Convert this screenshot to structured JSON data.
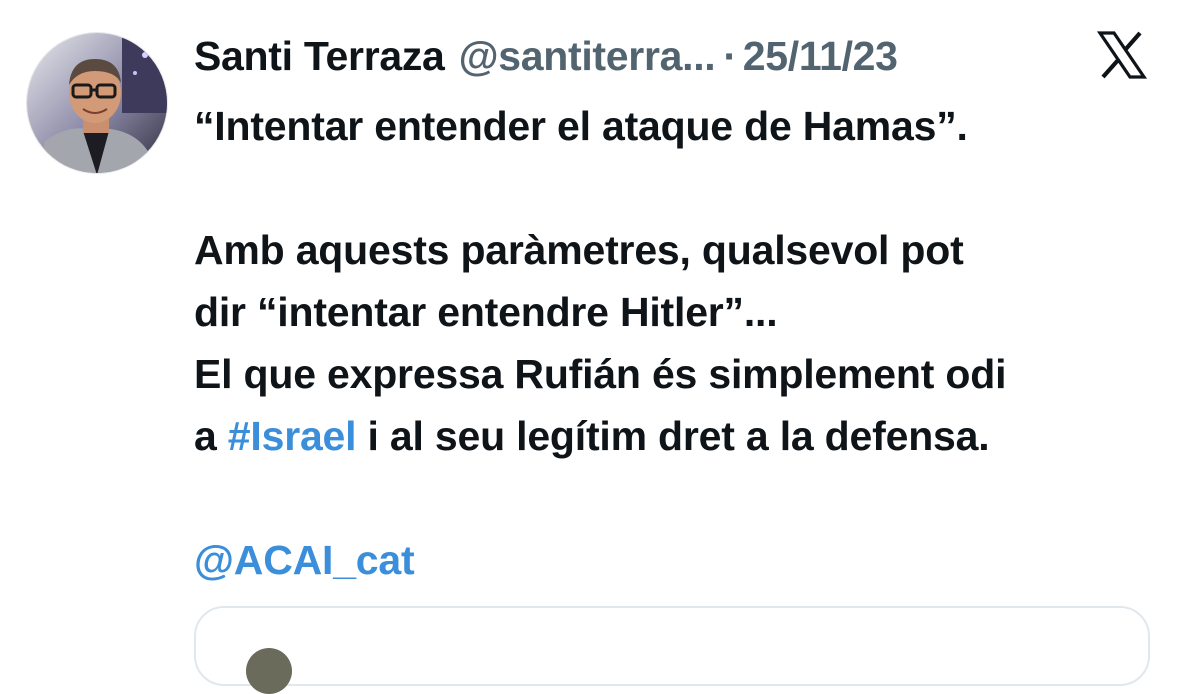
{
  "author": {
    "name": "Santi Terraza",
    "handle": "@santiterra...",
    "separator": "·",
    "date": "25/11/23"
  },
  "icons": {
    "avatar": "profile-photo",
    "platform": "x-logo-icon"
  },
  "tweet": {
    "line1": "“Intentar entender el ataque de Hamas”.",
    "line2": "Amb aquests paràmetres, qualsevol pot",
    "line3": "dir “intentar entendre Hitler”...",
    "line4": "El que expressa Rufián és simplement odi",
    "line5_prefix": "a ",
    "hashtag": "#Israel",
    "line5_suffix": " i al seu legítim dret a la defensa.",
    "mention": "@ACAI_cat"
  },
  "colors": {
    "text": "#0f1419",
    "secondary": "#536471",
    "link": "#3b8ed9"
  }
}
